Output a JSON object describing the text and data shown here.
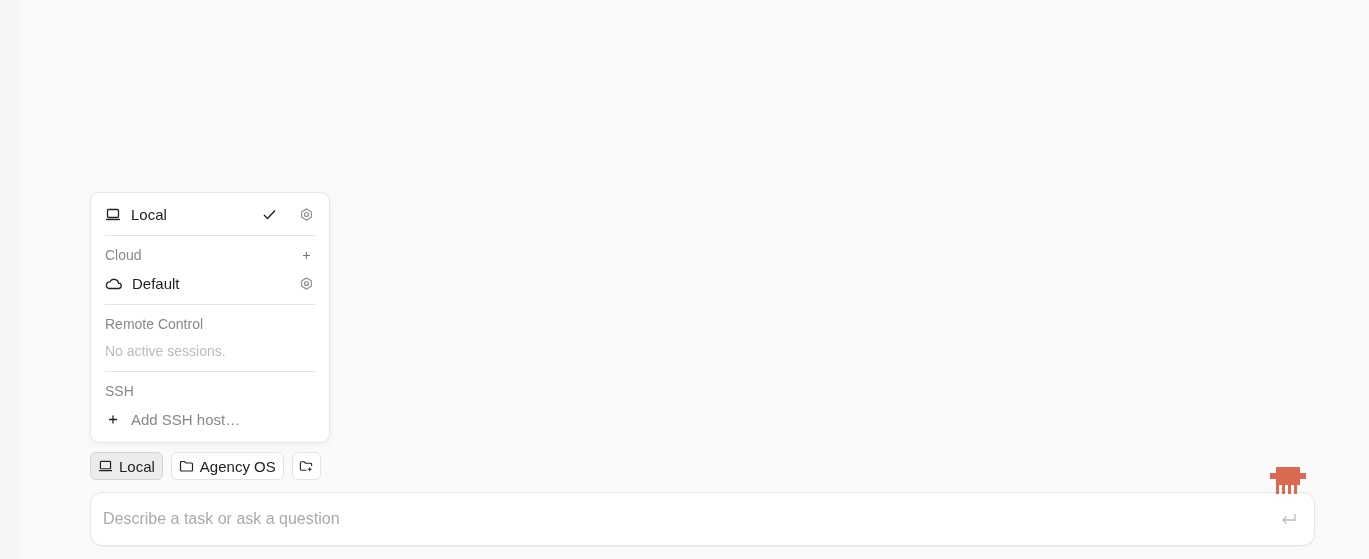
{
  "environment_menu": {
    "sections": [
      {
        "items": [
          {
            "kind": "local",
            "label": "Local",
            "selected": true,
            "settings": true
          }
        ]
      },
      {
        "title": "Cloud",
        "add": true,
        "items": [
          {
            "kind": "cloud",
            "label": "Default",
            "selected": false,
            "settings": true
          }
        ]
      },
      {
        "title": "Remote Control",
        "note": "No active sessions."
      },
      {
        "title": "SSH",
        "actions": [
          {
            "label": "Add SSH host…"
          }
        ]
      }
    ]
  },
  "chips": [
    {
      "kind": "environment",
      "label": "Local",
      "selected": true
    },
    {
      "kind": "folder",
      "label": "Agency OS",
      "selected": false
    },
    {
      "kind": "add-folder",
      "selected": false
    }
  ],
  "prompt": {
    "placeholder": "Describe a task or ask a question"
  }
}
